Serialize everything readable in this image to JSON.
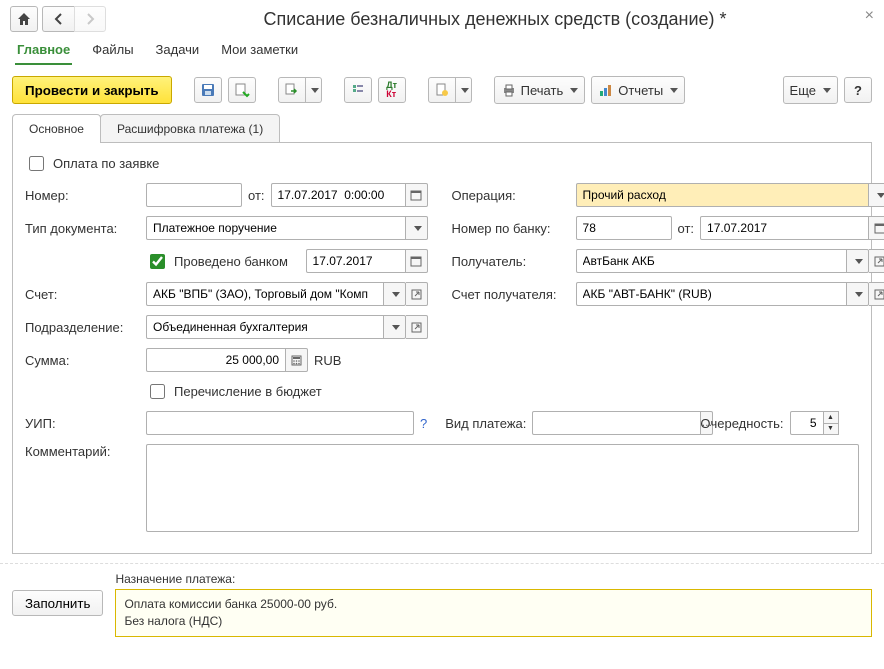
{
  "header": {
    "title": "Списание безналичных денежных средств (создание) *"
  },
  "tabs": {
    "main": "Главное",
    "files": "Файлы",
    "tasks": "Задачи",
    "notes": "Мои заметки"
  },
  "toolbar": {
    "post_close": "Провести и закрыть",
    "print": "Печать",
    "reports": "Отчеты",
    "more": "Еще",
    "help": "?"
  },
  "subtabs": {
    "main": "Основное",
    "decode": "Расшифровка платежа (1)"
  },
  "form": {
    "pay_by_request_lbl": "Оплата по заявке",
    "number_lbl": "Номер:",
    "number_val": "",
    "from1_lbl": "от:",
    "date1_val": "17.07.2017  0:00:00",
    "operation_lbl": "Операция:",
    "operation_val": "Прочий расход",
    "doctype_lbl": "Тип документа:",
    "doctype_val": "Платежное поручение",
    "banknum_lbl": "Номер по банку:",
    "banknum_val": "78",
    "from2_lbl": "от:",
    "date2_val": "17.07.2017",
    "bank_done_lbl": "Проведено банком",
    "bank_done_date": "17.07.2017",
    "recipient_lbl": "Получатель:",
    "recipient_val": "АвтБанк АКБ",
    "account_lbl": "Счет:",
    "account_val": "АКБ \"ВПБ\" (ЗАО), Торговый дом \"Комп",
    "recaccount_lbl": "Счет получателя:",
    "recaccount_val": "АКБ \"АВТ-БАНК\" (RUB)",
    "dept_lbl": "Подразделение:",
    "dept_val": "Объединенная бухгалтерия",
    "sum_lbl": "Сумма:",
    "sum_val": "25 000,00",
    "currency": "RUB",
    "budget_transfer_lbl": "Перечисление в бюджет",
    "uip_lbl": "УИП:",
    "uip_val": "",
    "paytype_lbl": "Вид платежа:",
    "paytype_val": "",
    "priority_lbl": "Очередность:",
    "priority_val": "5",
    "comment_lbl": "Комментарий:",
    "comment_val": ""
  },
  "bottom": {
    "fill": "Заполнить",
    "dest_lbl": "Назначение платежа:",
    "dest_text": "Оплата комиссии банка 25000-00 руб.\nБез налога (НДС)"
  }
}
